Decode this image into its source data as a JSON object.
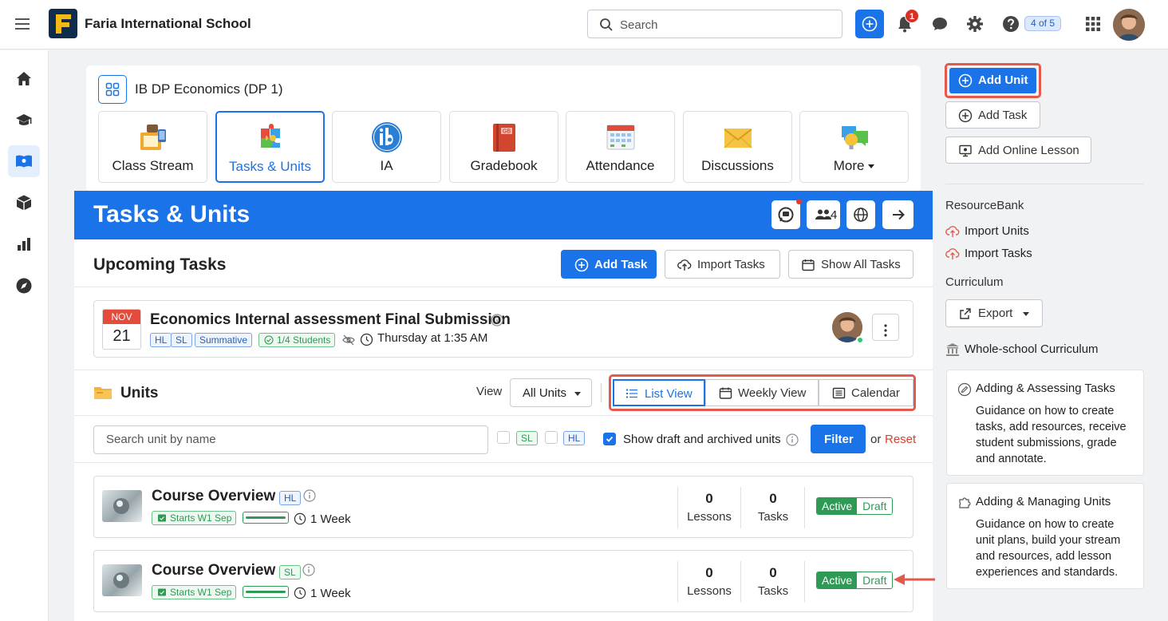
{
  "topbar": {
    "school_name": "Faria International School",
    "search_placeholder": "Search",
    "notification_count": "1",
    "help_counter": "4 of 5"
  },
  "class": {
    "title": "IB DP Economics (DP 1)",
    "tiles": [
      {
        "label": "Class Stream",
        "icon": "class-stream-icon"
      },
      {
        "label": "Tasks & Units",
        "icon": "puzzle-icon"
      },
      {
        "label": "IA",
        "icon": "ib-logo-icon"
      },
      {
        "label": "Gradebook",
        "icon": "gradebook-icon"
      },
      {
        "label": "Attendance",
        "icon": "calendar-icon"
      },
      {
        "label": "Discussions",
        "icon": "envelope-icon"
      },
      {
        "label": "More",
        "icon": "chat-bubbles-icon"
      }
    ]
  },
  "banner": {
    "title": "Tasks & Units",
    "members_count": "4"
  },
  "upcoming": {
    "title": "Upcoming Tasks",
    "add_task": "Add Task",
    "import_tasks": "Import Tasks",
    "show_all": "Show All Tasks",
    "task": {
      "month": "NOV",
      "day": "21",
      "title": "Economics Internal assessment Final Submission",
      "tag_hl": "HL",
      "tag_sl": "SL",
      "tag_type": "Summative",
      "tag_students": "1/4 Students",
      "when": "Thursday at 1:35 AM"
    }
  },
  "units": {
    "title": "Units",
    "view_label": "View",
    "view_select": "All Units",
    "views": [
      "List View",
      "Weekly View",
      "Calendar"
    ],
    "search_placeholder": "Search unit by name",
    "filter_sl": "SL",
    "filter_hl": "HL",
    "show_draft": "Show draft and archived units",
    "filter_btn": "Filter",
    "or": "or",
    "reset": "Reset",
    "items": [
      {
        "title": "Course Overview",
        "level": "HL",
        "starts": "Starts W1 Sep",
        "duration": "1 Week",
        "lessons": "0",
        "tasks": "0",
        "lessons_label": "Lessons",
        "tasks_label": "Tasks",
        "status_on": "Active",
        "status_off": "Draft",
        "progress": 1.0
      },
      {
        "title": "Course Overview",
        "level": "SL",
        "starts": "Starts W1 Sep",
        "duration": "1 Week",
        "lessons": "0",
        "tasks": "0",
        "lessons_label": "Lessons",
        "tasks_label": "Tasks",
        "status_on": "Active",
        "status_off": "Draft",
        "progress": 1.0
      }
    ]
  },
  "sidebar": {
    "add_unit": "Add Unit",
    "add_task": "Add Task",
    "add_online_lesson": "Add Online Lesson",
    "resourcebank_heading": "ResourceBank",
    "import_units": "Import Units",
    "import_tasks": "Import Tasks",
    "curriculum_heading": "Curriculum",
    "export": "Export",
    "whole_school": "Whole-school Curriculum",
    "guides": [
      {
        "title": "Adding & Assessing Tasks",
        "body": "Guidance on how to create tasks, add resources, receive student submissions, grade and annotate."
      },
      {
        "title": "Adding & Managing Units",
        "body": "Guidance on how to create unit plans, build your stream and resources, add lesson experiences and standards."
      }
    ]
  },
  "colors": {
    "primary": "#1a73e8",
    "highlight": "#e35a4c",
    "success": "#2f9a55"
  }
}
